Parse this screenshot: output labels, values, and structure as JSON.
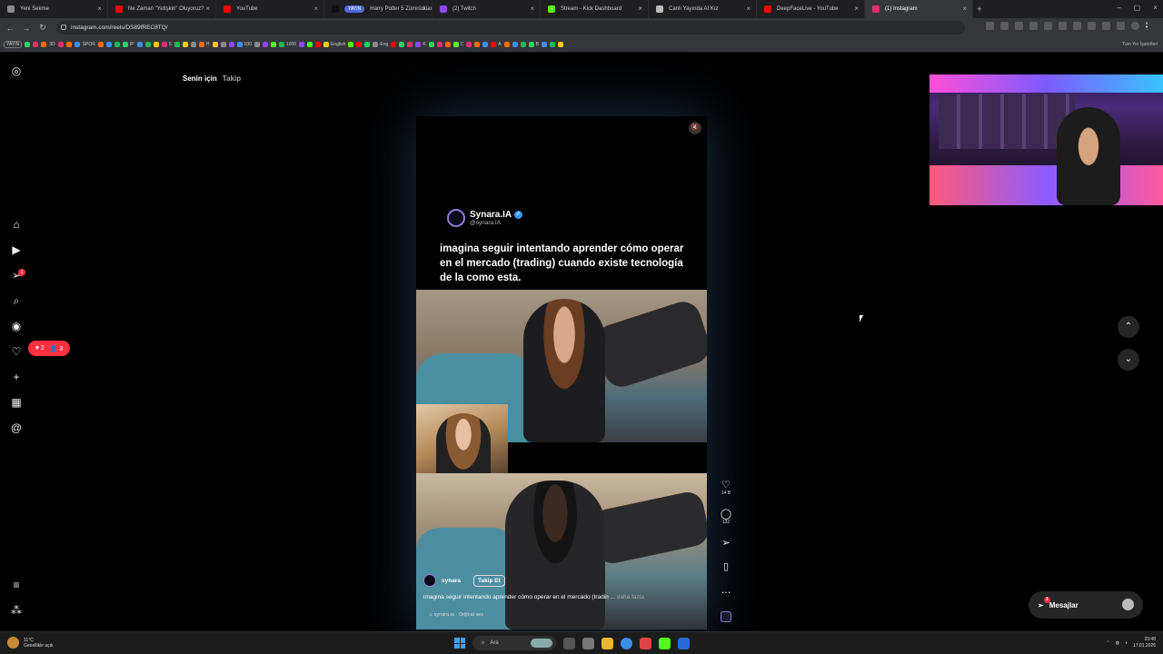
{
  "browser": {
    "tabs": [
      {
        "title": "Yeni Sekme",
        "color": "#8a8a8a"
      },
      {
        "title": "Ne Zaman \"Yetişkin\" Oluyoruz?",
        "color": "#ff0000"
      },
      {
        "title": "YouTube",
        "color": "#ff0000"
      },
      {
        "title": "Harry Potter 5 Zümrüdüanka Yo",
        "color": "#111111",
        "pill": "YAYIN"
      },
      {
        "title": "(2) Twitch",
        "color": "#9146ff"
      },
      {
        "title": "Stream - Kick Dashboard",
        "color": "#53fc18"
      },
      {
        "title": "Canlı Yayında AI Kız",
        "color": "#bbbbbb"
      },
      {
        "title": "DeepFaceLive - YouTube",
        "color": "#ff0000"
      },
      {
        "title": "(1) Instagram",
        "color": "#e1306c",
        "active": true
      }
    ],
    "url": "instagram.com/reels/DS89fREC8TQ/",
    "all_bookmarks": "Tüm Yer İşaretleri",
    "bookmarks": [
      {
        "label": "YAYIN",
        "tag": true
      },
      {
        "label": "3D",
        "tag": false
      },
      {
        "label": "SPOR",
        "tag": false
      },
      {
        "label": "IP",
        "tag": false
      },
      {
        "label": "S",
        "tag": false
      },
      {
        "label": "H",
        "tag": false
      },
      {
        "label": "100",
        "tag": false
      },
      {
        "label": "1000",
        "tag": false
      },
      {
        "label": "English",
        "tag": false
      },
      {
        "label": "Eng",
        "tag": false
      },
      {
        "label": "K",
        "tag": false
      },
      {
        "label": "C",
        "tag": false
      },
      {
        "label": "A",
        "tag": false
      },
      {
        "label": "B",
        "tag": false
      }
    ]
  },
  "instagram": {
    "feed_tabs": {
      "for_you": "Senin için",
      "following": "Takip"
    },
    "sidebar_badge": "1",
    "notifications": {
      "likes": "2",
      "follows": "3"
    },
    "reel": {
      "account_name": "Synara.IA",
      "account_handle": "@synara.IA",
      "overlay_caption": "imagina seguir intentando aprender cómo operar en el mercado (trading) cuando existe tecnología de la como esta.",
      "author_username": "synara",
      "follow_label": "Takip Et",
      "description": "imagina seguir intentando aprender cómo operar en el mercado (tradin ...",
      "more_label": "daha fazla",
      "audio": "synara.ia · Orijinal ses"
    },
    "actions": {
      "likes": "14 B",
      "comments": "132"
    },
    "messages": {
      "label": "Mesajlar",
      "badge": "1"
    }
  },
  "taskbar": {
    "weather_temp": "11°C",
    "weather_desc": "Genellikle açık",
    "search": "Ara",
    "time": "23:48",
    "date": "17.01.2026"
  },
  "colors": {
    "accent_red": "#ff3040",
    "verified_blue": "#3897f0"
  }
}
